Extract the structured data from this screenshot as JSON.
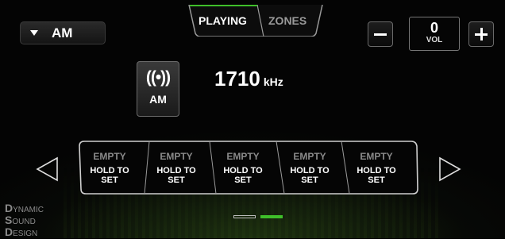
{
  "source": {
    "selected": "AM"
  },
  "tabs": [
    {
      "label": "PLAYING",
      "active": true
    },
    {
      "label": "ZONES",
      "active": false
    }
  ],
  "volume": {
    "value": "0",
    "label": "VOL"
  },
  "station": {
    "band": "AM",
    "frequency": "1710",
    "unit": "kHz"
  },
  "presets": [
    {
      "title": "EMPTY",
      "line1": "HOLD TO",
      "line2": "SET"
    },
    {
      "title": "EMPTY",
      "line1": "HOLD TO",
      "line2": "SET"
    },
    {
      "title": "EMPTY",
      "line1": "HOLD TO",
      "line2": "SET"
    },
    {
      "title": "EMPTY",
      "line1": "HOLD TO",
      "line2": "SET"
    },
    {
      "title": "EMPTY",
      "line1": "HOLD TO",
      "line2": "SET"
    }
  ],
  "pages": {
    "count": 2,
    "current": 2
  },
  "logo": {
    "lines": [
      "YNAMIC",
      "OUND",
      "ESIGN"
    ],
    "initials": [
      "D",
      "S",
      "D"
    ]
  },
  "colors": {
    "accent": "#3fbf2a",
    "background": "#040404"
  }
}
